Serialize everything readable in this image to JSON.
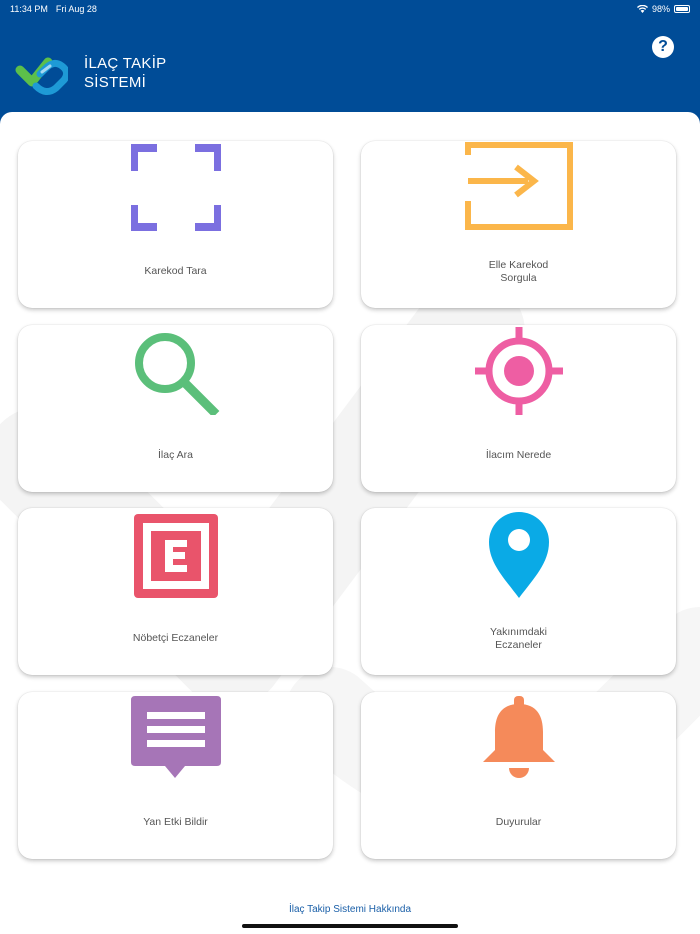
{
  "status_bar": {
    "time": "11:34 PM",
    "date": "Fri Aug 28",
    "battery": "98%"
  },
  "header": {
    "title_line1": "İLAÇ TAKİP",
    "title_line2": "SİSTEMİ",
    "help_label": "?"
  },
  "menu": [
    {
      "label": [
        "Karekod Tara"
      ],
      "icon": "scan-frame-icon",
      "color": "#7b6fe0"
    },
    {
      "label": [
        "Elle Karekod",
        "Sorgula"
      ],
      "icon": "input-arrow-icon",
      "color": "#fbb64a"
    },
    {
      "label": [
        "İlaç Ara"
      ],
      "icon": "magnifier-icon",
      "color": "#5bbf7a"
    },
    {
      "label": [
        "İlacım Nerede"
      ],
      "icon": "crosshair-icon",
      "color": "#ee5ea3"
    },
    {
      "label": [
        "Nöbetçi Eczaneler"
      ],
      "icon": "pharmacy-e-icon",
      "color": "#e9546b"
    },
    {
      "label": [
        "Yakınımdaki",
        "Eczaneler"
      ],
      "icon": "map-pin-icon",
      "color": "#0aaae6"
    },
    {
      "label": [
        "Yan Etki Bildir"
      ],
      "icon": "message-icon",
      "color": "#a675b7"
    },
    {
      "label": [
        "Duyurular"
      ],
      "icon": "bell-icon",
      "color": "#f58a5a"
    }
  ],
  "footer": {
    "about_link": "İlaç Takip Sistemi Hakkında"
  }
}
